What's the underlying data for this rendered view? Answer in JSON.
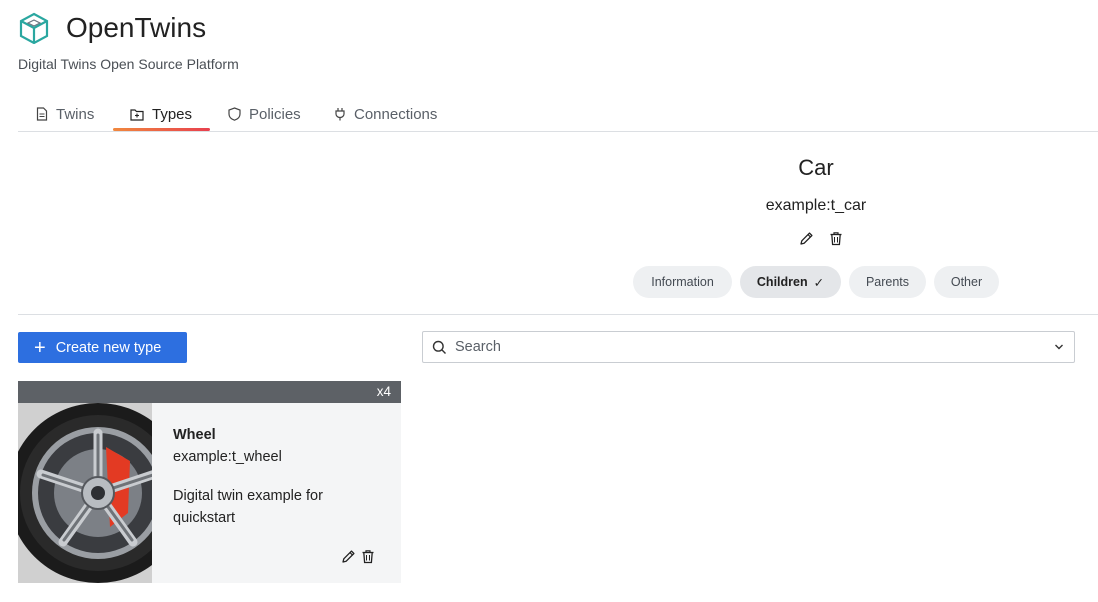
{
  "app": {
    "title": "OpenTwins",
    "subtitle": "Digital Twins Open Source Platform",
    "logo_icon": "cube-logo-icon"
  },
  "tabs": [
    {
      "label": "Twins",
      "icon": "document-icon",
      "active": false
    },
    {
      "label": "Types",
      "icon": "folder-icon",
      "active": true
    },
    {
      "label": "Policies",
      "icon": "shield-icon",
      "active": false
    },
    {
      "label": "Connections",
      "icon": "plug-icon",
      "active": false
    }
  ],
  "type": {
    "title": "Car",
    "id": "example:t_car"
  },
  "subtabs": [
    {
      "label": "Information",
      "active": false
    },
    {
      "label": "Children",
      "active": true,
      "suffix": "✓"
    },
    {
      "label": "Parents",
      "active": false
    },
    {
      "label": "Other",
      "active": false
    }
  ],
  "actions": {
    "create_label": "Create new type"
  },
  "search": {
    "placeholder": "Search"
  },
  "cards": [
    {
      "count": "x4",
      "name": "Wheel",
      "id": "example:t_wheel",
      "description": "Digital twin example for quickstart",
      "image": "car-wheel-photo"
    }
  ],
  "colors": {
    "accent": "#2d6fe0",
    "tab_underline_start": "#f0883e",
    "tab_underline_end": "#e8404e",
    "logo": "#2aa7a0"
  }
}
